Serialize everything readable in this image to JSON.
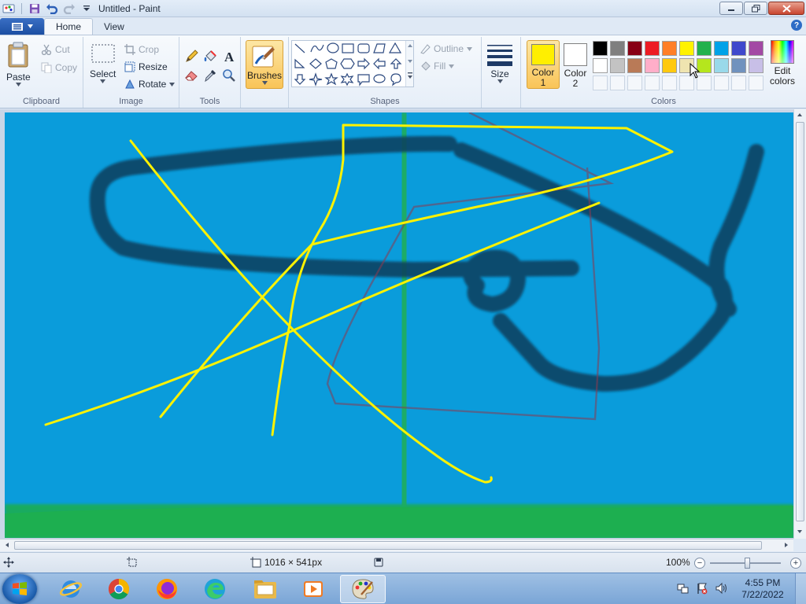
{
  "window": {
    "title": "Untitled - Paint"
  },
  "tabs": {
    "home": "Home",
    "view": "View"
  },
  "ribbon": {
    "clipboard": {
      "label": "Clipboard",
      "paste": "Paste",
      "cut": "Cut",
      "copy": "Copy"
    },
    "image": {
      "label": "Image",
      "select": "Select",
      "crop": "Crop",
      "resize": "Resize",
      "rotate": "Rotate"
    },
    "tools": {
      "label": "Tools"
    },
    "brushes": "Brushes",
    "shapes": {
      "label": "Shapes",
      "outline": "Outline",
      "fill": "Fill"
    },
    "size": "Size",
    "colors": {
      "label": "Colors",
      "color1_line1": "Color",
      "color1_line2": "1",
      "color2_line1": "Color",
      "color2_line2": "2",
      "edit_line1": "Edit",
      "edit_line2": "colors",
      "color1_value": "#ffef00",
      "color2_value": "#ffffff",
      "palette_row1": [
        "#000000",
        "#7f7f7f",
        "#880015",
        "#ed1c24",
        "#ff7f27",
        "#fff200",
        "#22b14c",
        "#00a2e8",
        "#3f48cc",
        "#a349a4"
      ],
      "palette_row2": [
        "#ffffff",
        "#c3c3c3",
        "#b97a57",
        "#ffaec9",
        "#ffc90e",
        "#efe4b0",
        "#b5e61d",
        "#99d9ea",
        "#7092be",
        "#c8bfe7"
      ]
    }
  },
  "status": {
    "canvas_size": "1016 × 541px",
    "zoom": "100%"
  },
  "taskbar": {
    "time": "4:55 PM",
    "date": "7/22/2022"
  }
}
